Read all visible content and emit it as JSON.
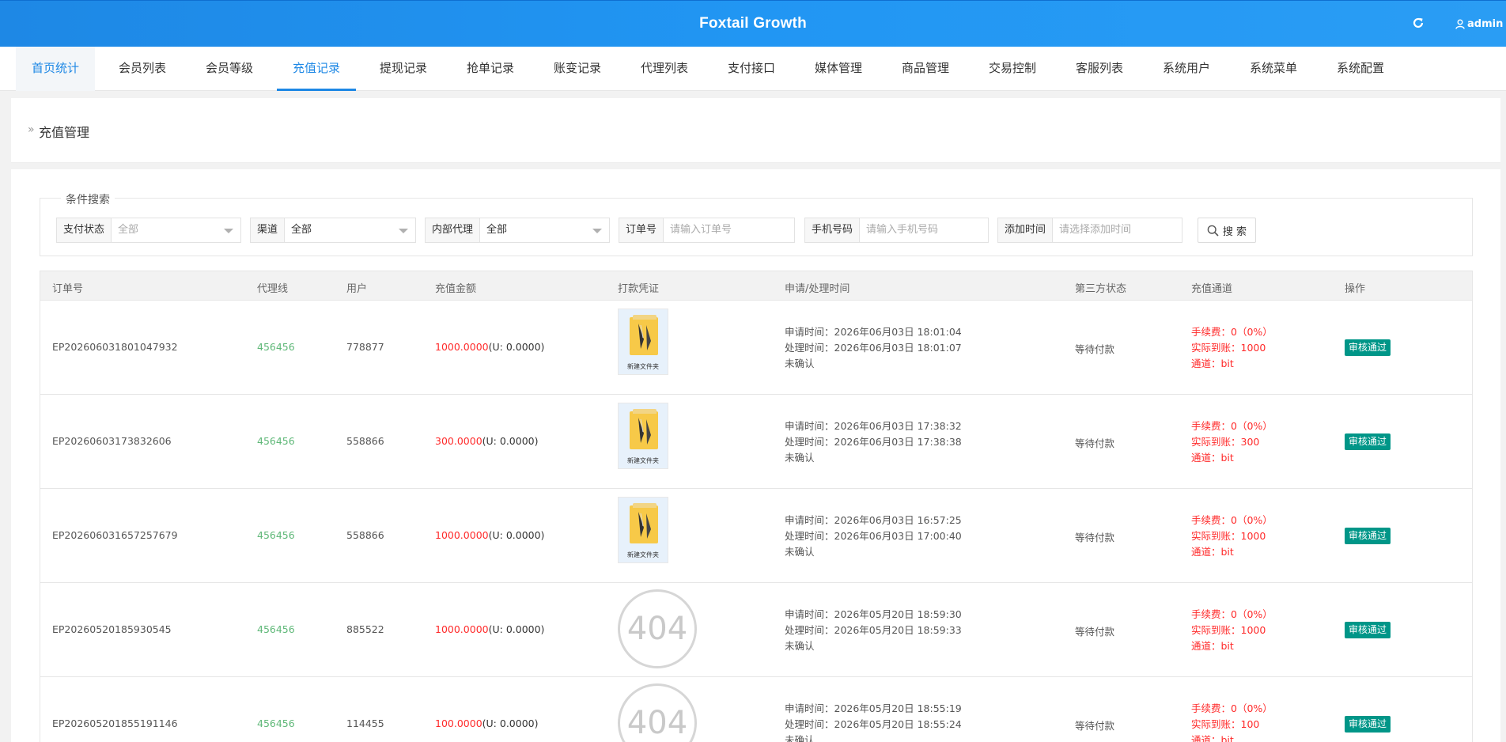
{
  "header": {
    "title": "Foxtail Growth",
    "user": "admin"
  },
  "nav": {
    "tabs": [
      "首页统计",
      "会员列表",
      "会员等级",
      "充值记录",
      "提现记录",
      "抢单记录",
      "账变记录",
      "代理列表",
      "支付接口",
      "媒体管理",
      "商品管理",
      "交易控制",
      "客服列表",
      "系统用户",
      "系统菜单",
      "系统配置"
    ]
  },
  "breadcrumb": "充值管理",
  "search": {
    "legend": "条件搜索",
    "pay_status_label": "支付状态",
    "pay_status_value": "全部",
    "channel_label": "渠道",
    "channel_value": "全部",
    "agent_label": "内部代理",
    "agent_value": "全部",
    "order_label": "订单号",
    "order_placeholder": "请输入订单号",
    "phone_label": "手机号码",
    "phone_placeholder": "请输入手机号码",
    "time_label": "添加时间",
    "time_placeholder": "请选择添加时间",
    "button": "搜 索"
  },
  "table": {
    "headers": [
      "订单号",
      "代理线",
      "用户",
      "充值金额",
      "打款凭证",
      "申请/处理时间",
      "第三方状态",
      "充值通道",
      "操作"
    ],
    "rows": [
      {
        "order": "EP202606031801047932",
        "agent": "456456",
        "user": "778877",
        "amount": "1000.0000",
        "usdt": "(U: 0.0000)",
        "proof": "image",
        "proof_caption": "新建文件夹",
        "apply": "申请时间：2026年06月03日 18:01:04",
        "process": "处理时间：2026年06月03日 18:01:07",
        "confirm": "未确认",
        "status": "等待付款",
        "fee": "手续费：0（0%）",
        "arrive": "实际到账：1000",
        "ch": "通道：bit",
        "action": "审核通过"
      },
      {
        "order": "EP20260603173832606",
        "agent": "456456",
        "user": "558866",
        "amount": "300.0000",
        "usdt": "(U: 0.0000)",
        "proof": "image",
        "proof_caption": "新建文件夹",
        "apply": "申请时间：2026年06月03日 17:38:32",
        "process": "处理时间：2026年06月03日 17:38:38",
        "confirm": "未确认",
        "status": "等待付款",
        "fee": "手续费：0（0%）",
        "arrive": "实际到账：300",
        "ch": "通道：bit",
        "action": "审核通过"
      },
      {
        "order": "EP202606031657257679",
        "agent": "456456",
        "user": "558866",
        "amount": "1000.0000",
        "usdt": "(U: 0.0000)",
        "proof": "image",
        "proof_caption": "新建文件夹",
        "apply": "申请时间：2026年06月03日 16:57:25",
        "process": "处理时间：2026年06月03日 17:00:40",
        "confirm": "未确认",
        "status": "等待付款",
        "fee": "手续费：0（0%）",
        "arrive": "实际到账：1000",
        "ch": "通道：bit",
        "action": "审核通过"
      },
      {
        "order": "EP20260520185930545",
        "agent": "456456",
        "user": "885522",
        "amount": "1000.0000",
        "usdt": "(U: 0.0000)",
        "proof": "404",
        "proof_caption": "404",
        "apply": "申请时间：2026年05月20日 18:59:30",
        "process": "处理时间：2026年05月20日 18:59:33",
        "confirm": "未确认",
        "status": "等待付款",
        "fee": "手续费：0（0%）",
        "arrive": "实际到账：1000",
        "ch": "通道：bit",
        "action": "审核通过"
      },
      {
        "order": "EP202605201855191146",
        "agent": "456456",
        "user": "114455",
        "amount": "100.0000",
        "usdt": "(U: 0.0000)",
        "proof": "404",
        "proof_caption": "404",
        "apply": "申请时间：2026年05月20日 18:55:19",
        "process": "处理时间：2026年05月20日 18:55:24",
        "confirm": "未确认",
        "status": "等待付款",
        "fee": "手续费：0（0%）",
        "arrive": "实际到账：100",
        "ch": "通道：bit",
        "action": "审核通过"
      }
    ]
  }
}
